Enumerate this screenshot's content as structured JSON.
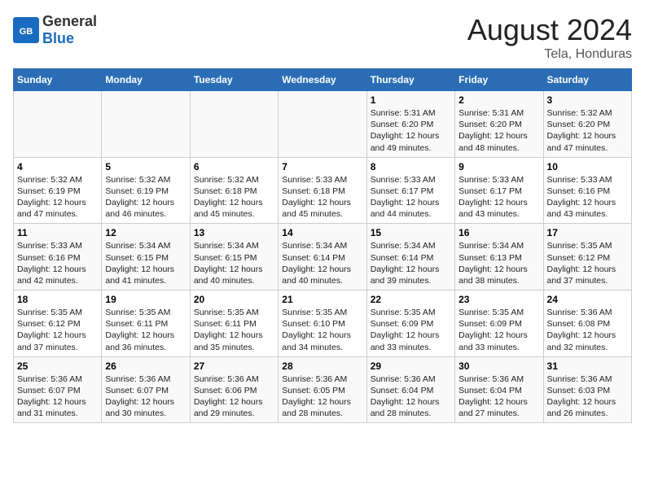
{
  "header": {
    "logo_general": "General",
    "logo_blue": "Blue",
    "month_year": "August 2024",
    "location": "Tela, Honduras"
  },
  "weekdays": [
    "Sunday",
    "Monday",
    "Tuesday",
    "Wednesday",
    "Thursday",
    "Friday",
    "Saturday"
  ],
  "weeks": [
    [
      {
        "day": "",
        "info": ""
      },
      {
        "day": "",
        "info": ""
      },
      {
        "day": "",
        "info": ""
      },
      {
        "day": "",
        "info": ""
      },
      {
        "day": "1",
        "info": "Sunrise: 5:31 AM\nSunset: 6:20 PM\nDaylight: 12 hours\nand 49 minutes."
      },
      {
        "day": "2",
        "info": "Sunrise: 5:31 AM\nSunset: 6:20 PM\nDaylight: 12 hours\nand 48 minutes."
      },
      {
        "day": "3",
        "info": "Sunrise: 5:32 AM\nSunset: 6:20 PM\nDaylight: 12 hours\nand 47 minutes."
      }
    ],
    [
      {
        "day": "4",
        "info": "Sunrise: 5:32 AM\nSunset: 6:19 PM\nDaylight: 12 hours\nand 47 minutes."
      },
      {
        "day": "5",
        "info": "Sunrise: 5:32 AM\nSunset: 6:19 PM\nDaylight: 12 hours\nand 46 minutes."
      },
      {
        "day": "6",
        "info": "Sunrise: 5:32 AM\nSunset: 6:18 PM\nDaylight: 12 hours\nand 45 minutes."
      },
      {
        "day": "7",
        "info": "Sunrise: 5:33 AM\nSunset: 6:18 PM\nDaylight: 12 hours\nand 45 minutes."
      },
      {
        "day": "8",
        "info": "Sunrise: 5:33 AM\nSunset: 6:17 PM\nDaylight: 12 hours\nand 44 minutes."
      },
      {
        "day": "9",
        "info": "Sunrise: 5:33 AM\nSunset: 6:17 PM\nDaylight: 12 hours\nand 43 minutes."
      },
      {
        "day": "10",
        "info": "Sunrise: 5:33 AM\nSunset: 6:16 PM\nDaylight: 12 hours\nand 43 minutes."
      }
    ],
    [
      {
        "day": "11",
        "info": "Sunrise: 5:33 AM\nSunset: 6:16 PM\nDaylight: 12 hours\nand 42 minutes."
      },
      {
        "day": "12",
        "info": "Sunrise: 5:34 AM\nSunset: 6:15 PM\nDaylight: 12 hours\nand 41 minutes."
      },
      {
        "day": "13",
        "info": "Sunrise: 5:34 AM\nSunset: 6:15 PM\nDaylight: 12 hours\nand 40 minutes."
      },
      {
        "day": "14",
        "info": "Sunrise: 5:34 AM\nSunset: 6:14 PM\nDaylight: 12 hours\nand 40 minutes."
      },
      {
        "day": "15",
        "info": "Sunrise: 5:34 AM\nSunset: 6:14 PM\nDaylight: 12 hours\nand 39 minutes."
      },
      {
        "day": "16",
        "info": "Sunrise: 5:34 AM\nSunset: 6:13 PM\nDaylight: 12 hours\nand 38 minutes."
      },
      {
        "day": "17",
        "info": "Sunrise: 5:35 AM\nSunset: 6:12 PM\nDaylight: 12 hours\nand 37 minutes."
      }
    ],
    [
      {
        "day": "18",
        "info": "Sunrise: 5:35 AM\nSunset: 6:12 PM\nDaylight: 12 hours\nand 37 minutes."
      },
      {
        "day": "19",
        "info": "Sunrise: 5:35 AM\nSunset: 6:11 PM\nDaylight: 12 hours\nand 36 minutes."
      },
      {
        "day": "20",
        "info": "Sunrise: 5:35 AM\nSunset: 6:11 PM\nDaylight: 12 hours\nand 35 minutes."
      },
      {
        "day": "21",
        "info": "Sunrise: 5:35 AM\nSunset: 6:10 PM\nDaylight: 12 hours\nand 34 minutes."
      },
      {
        "day": "22",
        "info": "Sunrise: 5:35 AM\nSunset: 6:09 PM\nDaylight: 12 hours\nand 33 minutes."
      },
      {
        "day": "23",
        "info": "Sunrise: 5:35 AM\nSunset: 6:09 PM\nDaylight: 12 hours\nand 33 minutes."
      },
      {
        "day": "24",
        "info": "Sunrise: 5:36 AM\nSunset: 6:08 PM\nDaylight: 12 hours\nand 32 minutes."
      }
    ],
    [
      {
        "day": "25",
        "info": "Sunrise: 5:36 AM\nSunset: 6:07 PM\nDaylight: 12 hours\nand 31 minutes."
      },
      {
        "day": "26",
        "info": "Sunrise: 5:36 AM\nSunset: 6:07 PM\nDaylight: 12 hours\nand 30 minutes."
      },
      {
        "day": "27",
        "info": "Sunrise: 5:36 AM\nSunset: 6:06 PM\nDaylight: 12 hours\nand 29 minutes."
      },
      {
        "day": "28",
        "info": "Sunrise: 5:36 AM\nSunset: 6:05 PM\nDaylight: 12 hours\nand 28 minutes."
      },
      {
        "day": "29",
        "info": "Sunrise: 5:36 AM\nSunset: 6:04 PM\nDaylight: 12 hours\nand 28 minutes."
      },
      {
        "day": "30",
        "info": "Sunrise: 5:36 AM\nSunset: 6:04 PM\nDaylight: 12 hours\nand 27 minutes."
      },
      {
        "day": "31",
        "info": "Sunrise: 5:36 AM\nSunset: 6:03 PM\nDaylight: 12 hours\nand 26 minutes."
      }
    ]
  ]
}
